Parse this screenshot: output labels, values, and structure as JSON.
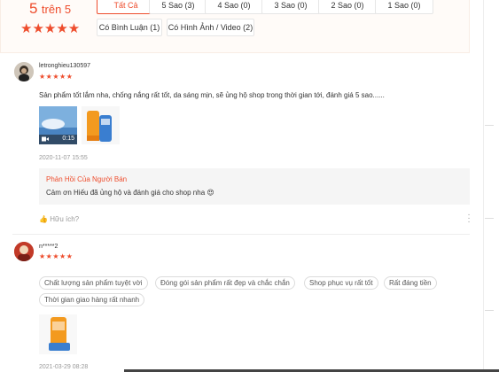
{
  "summary": {
    "score": "5",
    "out_of": "trên 5",
    "stars": "★★★★★"
  },
  "filters": [
    {
      "label": "Tất Cả",
      "active": true
    },
    {
      "label": "5 Sao (3)"
    },
    {
      "label": "4 Sao (0)"
    },
    {
      "label": "3 Sao (0)"
    },
    {
      "label": "2 Sao (0)"
    },
    {
      "label": "1 Sao (0)"
    },
    {
      "label": "Có Bình Luận (1)"
    },
    {
      "label": "Có Hình Ảnh / Video (2)"
    }
  ],
  "reviews": [
    {
      "username": "letronghieu130597",
      "stars": "★★★★★",
      "text": "Sản phẩm tốt lắm nha, chống nắng rất tốt, da sáng mịn, sẽ ủng hộ shop trong thời gian tới, đánh giá 5 sao......",
      "video_duration": "0:15",
      "time": "2020-11-07 15:55",
      "seller_reply_title": "Phản Hồi Của Người Bán",
      "seller_reply_text": "Cảm ơn Hiếu đã ủng hộ và đánh giá cho shop nha 😍",
      "like_label": "Hữu ích?"
    },
    {
      "username": "n*****2",
      "stars": "★★★★★",
      "tags": [
        "Chất lượng sản phẩm tuyệt vời",
        "Đóng gói sản phẩm rất đẹp và chắc chắn",
        "Shop phục vụ rất tốt",
        "Rất đáng tiền",
        "Thời gian giao hàng rất nhanh"
      ],
      "time": "2021-03-29 08:28"
    }
  ],
  "colors": {
    "accent": "#ee4d2d"
  }
}
